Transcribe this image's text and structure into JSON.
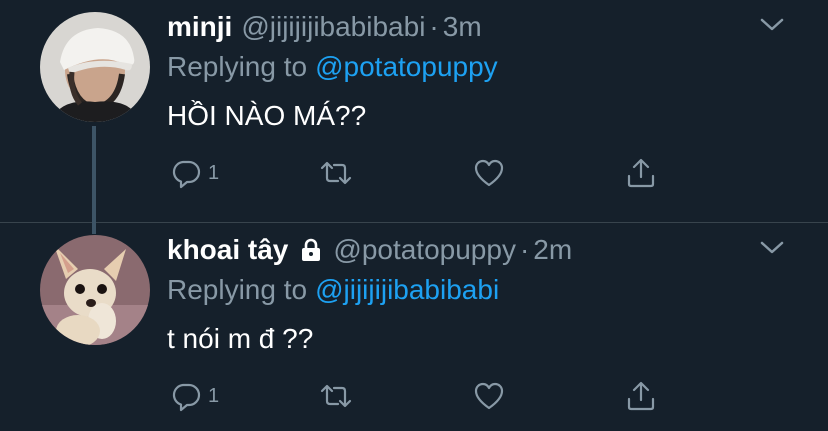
{
  "tweets": [
    {
      "display_name": "minji",
      "handle": "@jijijijibabibabi",
      "separator": "·",
      "time": "3m",
      "replying_prefix": "Replying to",
      "replying_to": "@potatopuppy",
      "text": "HỒI NÀO MÁ??",
      "reply_count": "1",
      "protected": false,
      "avatar_icon": "person-with-cap-avatar"
    },
    {
      "display_name": "khoai tây",
      "handle": "@potatopuppy",
      "separator": "·",
      "time": "2m",
      "replying_prefix": "Replying to",
      "replying_to": "@jijijijibabibabi",
      "text": "t nói m đ ??",
      "reply_count": "1",
      "protected": true,
      "avatar_icon": "chihuahua-dog-avatar"
    }
  ],
  "colors": {
    "background": "#15202b",
    "text": "#ffffff",
    "secondary": "#8899a6",
    "link": "#1da1f2",
    "thread_line": "#3d5466",
    "divider": "#38444d"
  },
  "icons": [
    "reply-icon",
    "retweet-icon",
    "like-icon",
    "share-icon",
    "caret-down-icon",
    "lock-icon"
  ]
}
